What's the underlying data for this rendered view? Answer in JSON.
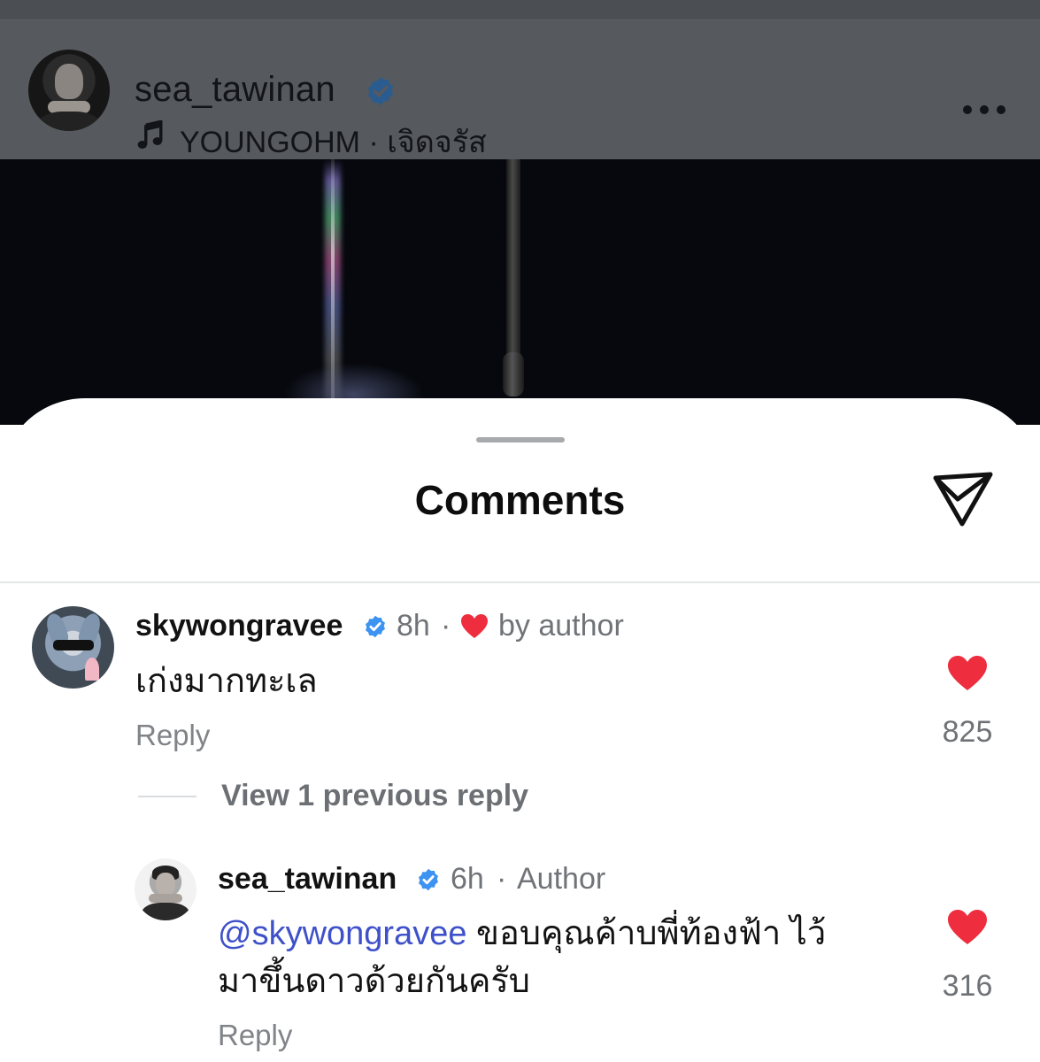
{
  "colors": {
    "overlay": "#56595d",
    "sheet_background": "#ffffff",
    "like_red": "#ee2d3e",
    "verified_blue": "#3d93f2",
    "mention_blue": "#3f51c9",
    "secondary_text": "#707377"
  },
  "post_header": {
    "username": "sea_tawinan",
    "verified": true,
    "music_icon": "music-note-icon",
    "music": "YOUNGOHM · เจิดจรัส",
    "more_icon": "more-horizontal-icon"
  },
  "sheet": {
    "title": "Comments",
    "share_icon": "send-icon"
  },
  "comments": [
    {
      "username": "skywongravee",
      "verified": true,
      "time": "8h",
      "separator": "·",
      "author_like_label": "by author",
      "text": "เก่งมากทะเล",
      "reply_label": "Reply",
      "likes": "825"
    }
  ],
  "thread": {
    "view_previous": "View 1 previous reply"
  },
  "reply": {
    "username": "sea_tawinan",
    "verified": true,
    "time": "6h",
    "separator": "·",
    "badge": "Author",
    "mention": "@skywongravee",
    "text_line1": " ขอบคุณค้าบพี่ท้องฟ้า ไว้",
    "text_line2": "มาขึ้นดาวด้วยกันครับ",
    "reply_label": "Reply",
    "likes": "316"
  }
}
